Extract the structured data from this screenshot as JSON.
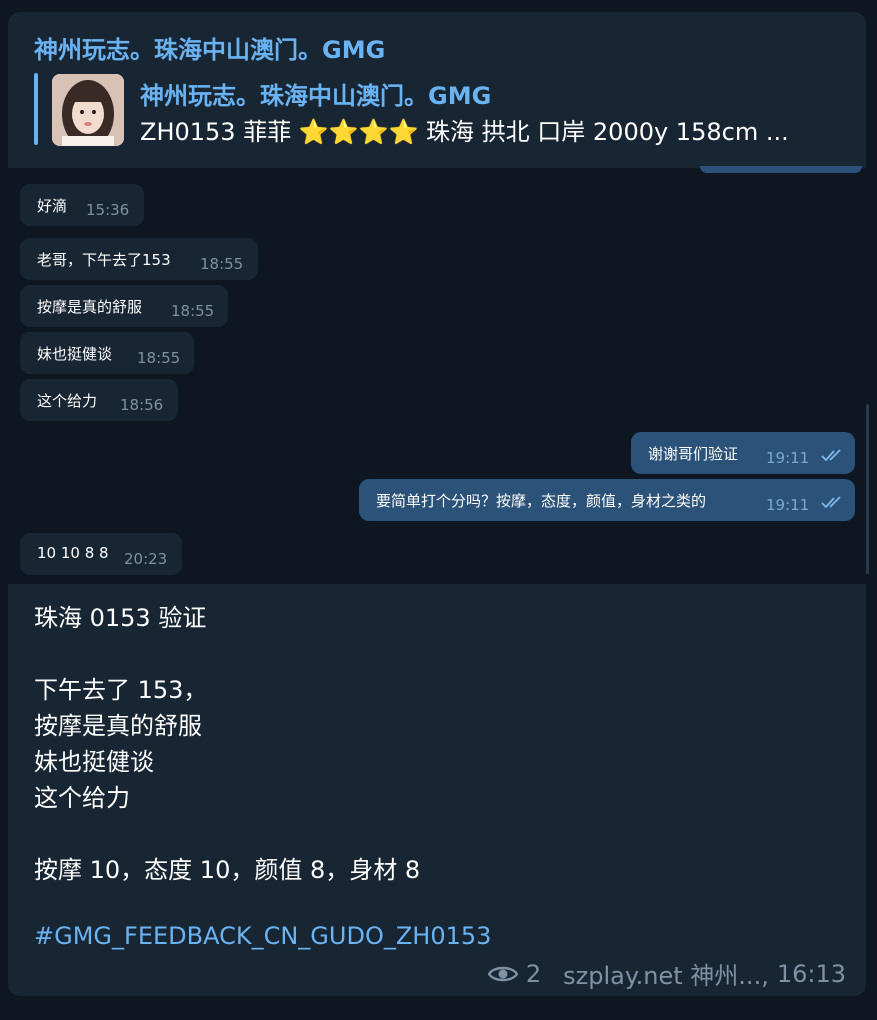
{
  "quote": {
    "header_title": "神州玩志。珠海中山澳门。GMG",
    "name": "神州玩志。珠海中山澳门。GMG",
    "text_prefix": "ZH0153 菲菲",
    "stars": "⭐⭐⭐⭐",
    "text_suffix": "珠海 拱北 口岸 2000y  158cm ..."
  },
  "messages": [
    {
      "dir": "in",
      "text": "好滴",
      "time": "15:36"
    },
    {
      "dir": "in",
      "text": "老哥，下午去了153",
      "time": "18:55"
    },
    {
      "dir": "in",
      "text": "按摩是真的舒服",
      "time": "18:55"
    },
    {
      "dir": "in",
      "text": "妹也挺健谈",
      "time": "18:55"
    },
    {
      "dir": "in",
      "text": "这个给力",
      "time": "18:56"
    },
    {
      "dir": "out",
      "text": "谢谢哥们验证",
      "time": "19:11",
      "status": "read"
    },
    {
      "dir": "out",
      "text": "要简单打个分吗？按摩，态度，颜值，身材之类的",
      "time": "19:11",
      "status": "read"
    },
    {
      "dir": "in",
      "text": "10 10 8 8",
      "time": "20:23"
    }
  ],
  "post": {
    "line1": "珠海 0153 验证",
    "line2": "下午去了 153，",
    "line3": "按摩是真的舒服",
    "line4": "妹也挺健谈",
    "line5": "这个给力",
    "line6": "按摩 10，态度 10，颜值 8，身材 8",
    "hashtag": "#GMG_FEEDBACK_CN_GUDO_ZH0153",
    "views": "2",
    "author": "szplay.net 神州...,",
    "time": "16:13",
    "views_icon": "eye-icon"
  },
  "colors": {
    "background": "#0e1621",
    "incoming_bubble": "#182533",
    "outgoing_bubble": "#2b5278",
    "accent": "#6ab3f3",
    "meta_text": "#7f91a4"
  }
}
